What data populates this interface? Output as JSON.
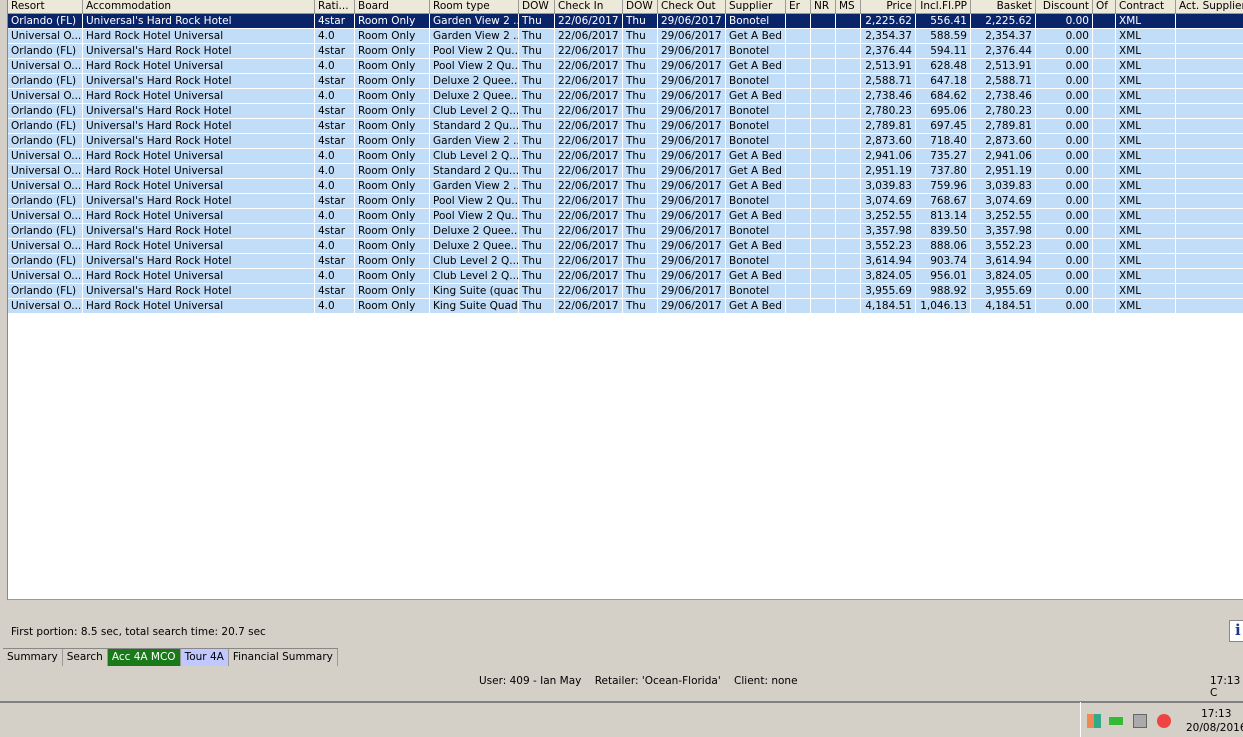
{
  "columns": [
    "Resort",
    "Accommodation",
    "Rati...",
    "Board",
    "Room type",
    "DOW",
    "Check In",
    "DOW",
    "Check Out",
    "Supplier",
    "Er",
    "NR",
    "MS",
    "Price",
    "Incl.Fl.PP",
    "Basket",
    "Discount",
    "Of",
    "Contract",
    "Act. Supplier"
  ],
  "rows": [
    [
      "Orlando (FL)",
      "Universal's Hard Rock Hotel",
      "4star",
      "Room Only",
      "Garden View 2 ...",
      "Thu",
      "22/06/2017",
      "Thu",
      "29/06/2017",
      "Bonotel",
      "",
      "",
      "",
      "2,225.62",
      "556.41",
      "2,225.62",
      "0.00",
      "",
      "XML",
      ""
    ],
    [
      "Universal O...",
      "Hard Rock Hotel Universal",
      "4.0",
      "Room Only",
      "Garden View 2 ...",
      "Thu",
      "22/06/2017",
      "Thu",
      "29/06/2017",
      "Get A Bed",
      "",
      "",
      "",
      "2,354.37",
      "588.59",
      "2,354.37",
      "0.00",
      "",
      "XML",
      ""
    ],
    [
      "Orlando (FL)",
      "Universal's Hard Rock Hotel",
      "4star",
      "Room Only",
      "Pool View 2 Qu...",
      "Thu",
      "22/06/2017",
      "Thu",
      "29/06/2017",
      "Bonotel",
      "",
      "",
      "",
      "2,376.44",
      "594.11",
      "2,376.44",
      "0.00",
      "",
      "XML",
      ""
    ],
    [
      "Universal O...",
      "Hard Rock Hotel Universal",
      "4.0",
      "Room Only",
      "Pool View 2 Qu...",
      "Thu",
      "22/06/2017",
      "Thu",
      "29/06/2017",
      "Get A Bed",
      "",
      "",
      "",
      "2,513.91",
      "628.48",
      "2,513.91",
      "0.00",
      "",
      "XML",
      ""
    ],
    [
      "Orlando (FL)",
      "Universal's Hard Rock Hotel",
      "4star",
      "Room Only",
      "Deluxe 2 Quee...",
      "Thu",
      "22/06/2017",
      "Thu",
      "29/06/2017",
      "Bonotel",
      "",
      "",
      "",
      "2,588.71",
      "647.18",
      "2,588.71",
      "0.00",
      "",
      "XML",
      ""
    ],
    [
      "Universal O...",
      "Hard Rock Hotel Universal",
      "4.0",
      "Room Only",
      "Deluxe 2 Quee...",
      "Thu",
      "22/06/2017",
      "Thu",
      "29/06/2017",
      "Get A Bed",
      "",
      "",
      "",
      "2,738.46",
      "684.62",
      "2,738.46",
      "0.00",
      "",
      "XML",
      ""
    ],
    [
      "Orlando (FL)",
      "Universal's Hard Rock Hotel",
      "4star",
      "Room Only",
      "Club Level 2 Q...",
      "Thu",
      "22/06/2017",
      "Thu",
      "29/06/2017",
      "Bonotel",
      "",
      "",
      "",
      "2,780.23",
      "695.06",
      "2,780.23",
      "0.00",
      "",
      "XML",
      ""
    ],
    [
      "Orlando (FL)",
      "Universal's Hard Rock Hotel",
      "4star",
      "Room Only",
      "Standard 2 Qu...",
      "Thu",
      "22/06/2017",
      "Thu",
      "29/06/2017",
      "Bonotel",
      "",
      "",
      "",
      "2,789.81",
      "697.45",
      "2,789.81",
      "0.00",
      "",
      "XML",
      ""
    ],
    [
      "Orlando (FL)",
      "Universal's Hard Rock Hotel",
      "4star",
      "Room Only",
      "Garden View 2 ...",
      "Thu",
      "22/06/2017",
      "Thu",
      "29/06/2017",
      "Bonotel",
      "",
      "",
      "",
      "2,873.60",
      "718.40",
      "2,873.60",
      "0.00",
      "",
      "XML",
      ""
    ],
    [
      "Universal O...",
      "Hard Rock Hotel Universal",
      "4.0",
      "Room Only",
      "Club Level 2 Q...",
      "Thu",
      "22/06/2017",
      "Thu",
      "29/06/2017",
      "Get A Bed",
      "",
      "",
      "",
      "2,941.06",
      "735.27",
      "2,941.06",
      "0.00",
      "",
      "XML",
      ""
    ],
    [
      "Universal O...",
      "Hard Rock Hotel Universal",
      "4.0",
      "Room Only",
      "Standard 2 Qu...",
      "Thu",
      "22/06/2017",
      "Thu",
      "29/06/2017",
      "Get A Bed",
      "",
      "",
      "",
      "2,951.19",
      "737.80",
      "2,951.19",
      "0.00",
      "",
      "XML",
      ""
    ],
    [
      "Universal O...",
      "Hard Rock Hotel Universal",
      "4.0",
      "Room Only",
      "Garden View 2 ...",
      "Thu",
      "22/06/2017",
      "Thu",
      "29/06/2017",
      "Get A Bed",
      "",
      "",
      "",
      "3,039.83",
      "759.96",
      "3,039.83",
      "0.00",
      "",
      "XML",
      ""
    ],
    [
      "Orlando (FL)",
      "Universal's Hard Rock Hotel",
      "4star",
      "Room Only",
      "Pool View 2 Qu...",
      "Thu",
      "22/06/2017",
      "Thu",
      "29/06/2017",
      "Bonotel",
      "",
      "",
      "",
      "3,074.69",
      "768.67",
      "3,074.69",
      "0.00",
      "",
      "XML",
      ""
    ],
    [
      "Universal O...",
      "Hard Rock Hotel Universal",
      "4.0",
      "Room Only",
      "Pool View 2 Qu...",
      "Thu",
      "22/06/2017",
      "Thu",
      "29/06/2017",
      "Get A Bed",
      "",
      "",
      "",
      "3,252.55",
      "813.14",
      "3,252.55",
      "0.00",
      "",
      "XML",
      ""
    ],
    [
      "Orlando (FL)",
      "Universal's Hard Rock Hotel",
      "4star",
      "Room Only",
      "Deluxe 2 Quee...",
      "Thu",
      "22/06/2017",
      "Thu",
      "29/06/2017",
      "Bonotel",
      "",
      "",
      "",
      "3,357.98",
      "839.50",
      "3,357.98",
      "0.00",
      "",
      "XML",
      ""
    ],
    [
      "Universal O...",
      "Hard Rock Hotel Universal",
      "4.0",
      "Room Only",
      "Deluxe 2 Quee...",
      "Thu",
      "22/06/2017",
      "Thu",
      "29/06/2017",
      "Get A Bed",
      "",
      "",
      "",
      "3,552.23",
      "888.06",
      "3,552.23",
      "0.00",
      "",
      "XML",
      ""
    ],
    [
      "Orlando (FL)",
      "Universal's Hard Rock Hotel",
      "4star",
      "Room Only",
      "Club Level 2 Q...",
      "Thu",
      "22/06/2017",
      "Thu",
      "29/06/2017",
      "Bonotel",
      "",
      "",
      "",
      "3,614.94",
      "903.74",
      "3,614.94",
      "0.00",
      "",
      "XML",
      ""
    ],
    [
      "Universal O...",
      "Hard Rock Hotel Universal",
      "4.0",
      "Room Only",
      "Club Level 2 Q...",
      "Thu",
      "22/06/2017",
      "Thu",
      "29/06/2017",
      "Get A Bed",
      "",
      "",
      "",
      "3,824.05",
      "956.01",
      "3,824.05",
      "0.00",
      "",
      "XML",
      ""
    ],
    [
      "Orlando (FL)",
      "Universal's Hard Rock Hotel",
      "4star",
      "Room Only",
      "King Suite (quad)",
      "Thu",
      "22/06/2017",
      "Thu",
      "29/06/2017",
      "Bonotel",
      "",
      "",
      "",
      "3,955.69",
      "988.92",
      "3,955.69",
      "0.00",
      "",
      "XML",
      ""
    ],
    [
      "Universal O...",
      "Hard Rock Hotel Universal",
      "4.0",
      "Room Only",
      "King Suite Quad",
      "Thu",
      "22/06/2017",
      "Thu",
      "29/06/2017",
      "Get A Bed",
      "",
      "",
      "",
      "4,184.51",
      "1,046.13",
      "4,184.51",
      "0.00",
      "",
      "XML",
      ""
    ]
  ],
  "status": "First portion: 8.5 sec, total search time: 20.7 sec",
  "info_label": "i",
  "tabs": [
    "Summary",
    "Search",
    "Acc 4A MCO",
    "Tour 4A",
    "Financial Summary"
  ],
  "user_line": "User: 409 - Ian May    Retailer: 'Ocean-Florida'    Client: none",
  "time_status": "17:13 C",
  "taskbar": {
    "time": "17:13",
    "date": "20/08/2016"
  },
  "colors": {
    "selected": "#0a246a",
    "row": "#c2ddf8",
    "tab_active": "#1a7a1a",
    "tab_tour": "#c0c8ff"
  }
}
